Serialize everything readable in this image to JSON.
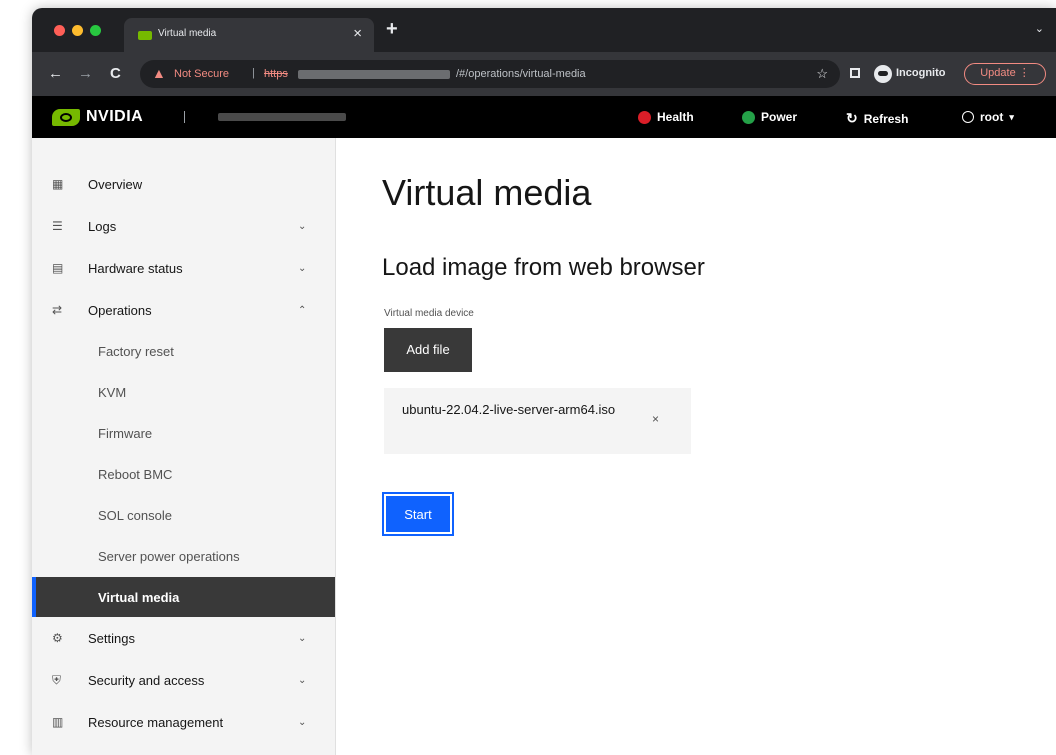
{
  "browser": {
    "tab_title": "Virtual media",
    "tab_close": "×",
    "new_tab": "+",
    "tab_menu": "⌄",
    "back": "←",
    "forward": "→",
    "reload": "C",
    "security_warning": "Not Secure",
    "url_separator": "|",
    "url_scheme": "https",
    "url_path": "/#/operations/virtual-media",
    "bookmark_star": "☆",
    "incognito_label": "Incognito",
    "update_label": "Update",
    "colors": {
      "warning": "#f28b82",
      "chrome_dark": "#202124",
      "chrome_toolbar": "#35363a"
    }
  },
  "header": {
    "brand": "NVIDIA",
    "health_label": "Health",
    "power_label": "Power",
    "refresh_label": "Refresh",
    "user_label": "root",
    "user_caret": "▾",
    "colors": {
      "health": "#da1e28",
      "power": "#24a148",
      "brand": "#76b900"
    }
  },
  "sidebar": {
    "items": [
      {
        "label": "Overview",
        "icon": "dashboard-icon",
        "expandable": false
      },
      {
        "label": "Logs",
        "icon": "logs-icon",
        "expandable": true,
        "expanded": false
      },
      {
        "label": "Hardware status",
        "icon": "hardware-icon",
        "expandable": true,
        "expanded": false
      },
      {
        "label": "Operations",
        "icon": "operations-icon",
        "expandable": true,
        "expanded": true
      }
    ],
    "operations_sub": [
      {
        "label": "Factory reset"
      },
      {
        "label": "KVM"
      },
      {
        "label": "Firmware"
      },
      {
        "label": "Reboot BMC"
      },
      {
        "label": "SOL console"
      },
      {
        "label": "Server power operations"
      },
      {
        "label": "Virtual media",
        "active": true
      }
    ],
    "items_after": [
      {
        "label": "Settings",
        "icon": "settings-icon",
        "expandable": true
      },
      {
        "label": "Security and access",
        "icon": "security-icon",
        "expandable": true
      },
      {
        "label": "Resource management",
        "icon": "resource-icon",
        "expandable": true
      }
    ],
    "chevron_down": "⌄",
    "chevron_up": "⌃"
  },
  "main": {
    "page_title": "Virtual media",
    "section_title": "Load image from web browser",
    "device_label": "Virtual media device",
    "add_file_label": "Add file",
    "file_name": "ubuntu-22.04.2-live-server-arm64.iso",
    "remove_file": "×",
    "start_label": "Start",
    "colors": {
      "primary": "#0f62fe",
      "secondary": "#393939"
    }
  }
}
